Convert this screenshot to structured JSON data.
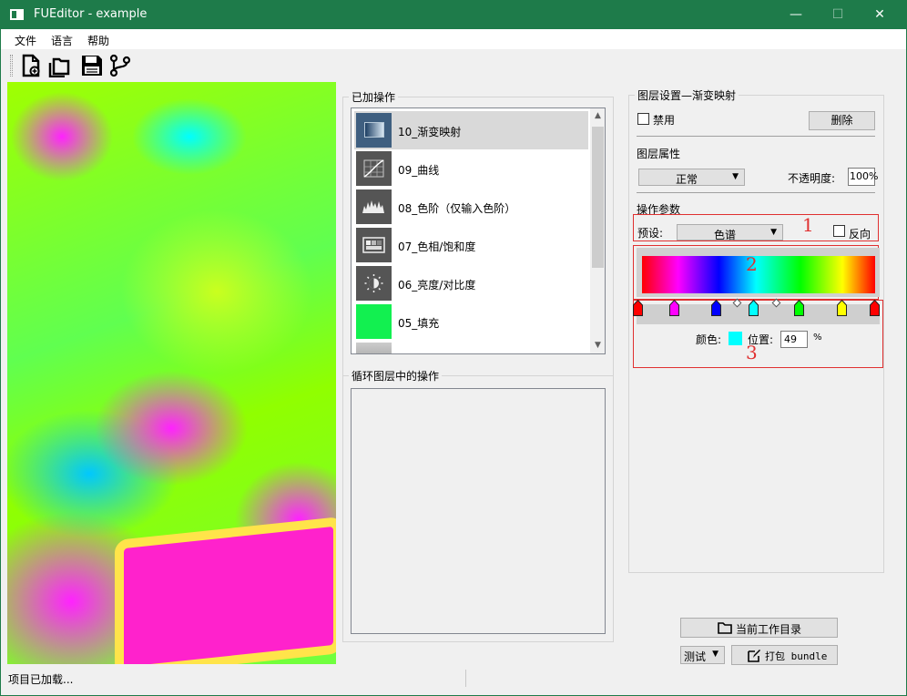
{
  "window": {
    "title": "FUEditor - example",
    "minimize": "—",
    "maximize": "☐",
    "close": "✕"
  },
  "menu": [
    "文件",
    "语言",
    "帮助"
  ],
  "toolbar": [
    "new-file-icon",
    "open-folder-icon",
    "save-icon",
    "branch-icon"
  ],
  "ops_panel": {
    "title": "已加操作",
    "items": [
      {
        "label": "10_渐变映射",
        "icon": "gradient-map-icon",
        "selected": true
      },
      {
        "label": "09_曲线",
        "icon": "curves-icon"
      },
      {
        "label": "08_色阶（仅输入色阶）",
        "icon": "levels-icon"
      },
      {
        "label": "07_色相/饱和度",
        "icon": "hue-saturation-icon"
      },
      {
        "label": "06_亮度/对比度",
        "icon": "brightness-icon"
      },
      {
        "label": "05_填充",
        "icon": "fill-icon"
      }
    ]
  },
  "loop_panel": {
    "title": "循环图层中的操作"
  },
  "layer_settings": {
    "title": "图层设置—渐变映射",
    "disable_label": "禁用",
    "delete_label": "删除",
    "props_title": "图层属性",
    "blend_mode": "正常",
    "opacity_label": "不透明度:",
    "opacity_value": "100%",
    "params_title": "操作参数",
    "preset_label": "预设:",
    "preset_value": "色谱",
    "reverse_label": "反向",
    "color_label": "颜色:",
    "position_label": "位置:",
    "position_value": "49",
    "position_unit": "%",
    "annotation_numbers": [
      "1",
      "2",
      "3"
    ],
    "gradient_stops": [
      {
        "color": "#ff0000",
        "position": 0
      },
      {
        "color": "#ff00ff",
        "position": 15.5
      },
      {
        "color": "#0000ff",
        "position": 33
      },
      {
        "color": "#00ffff",
        "position": 49
      },
      {
        "color": "#00ff00",
        "position": 68
      },
      {
        "color": "#ffff00",
        "position": 86
      },
      {
        "color": "#ff0000",
        "position": 100
      }
    ],
    "selected_color": "#00ffff"
  },
  "bottom": {
    "workdir_label": "当前工作目录",
    "mode_value": "测试",
    "pack_label": "打包 bundle"
  },
  "status": {
    "text": "项目已加载..."
  },
  "colors": {
    "title_bar": "#1e7b4a",
    "annotation_red": "#e03030"
  }
}
